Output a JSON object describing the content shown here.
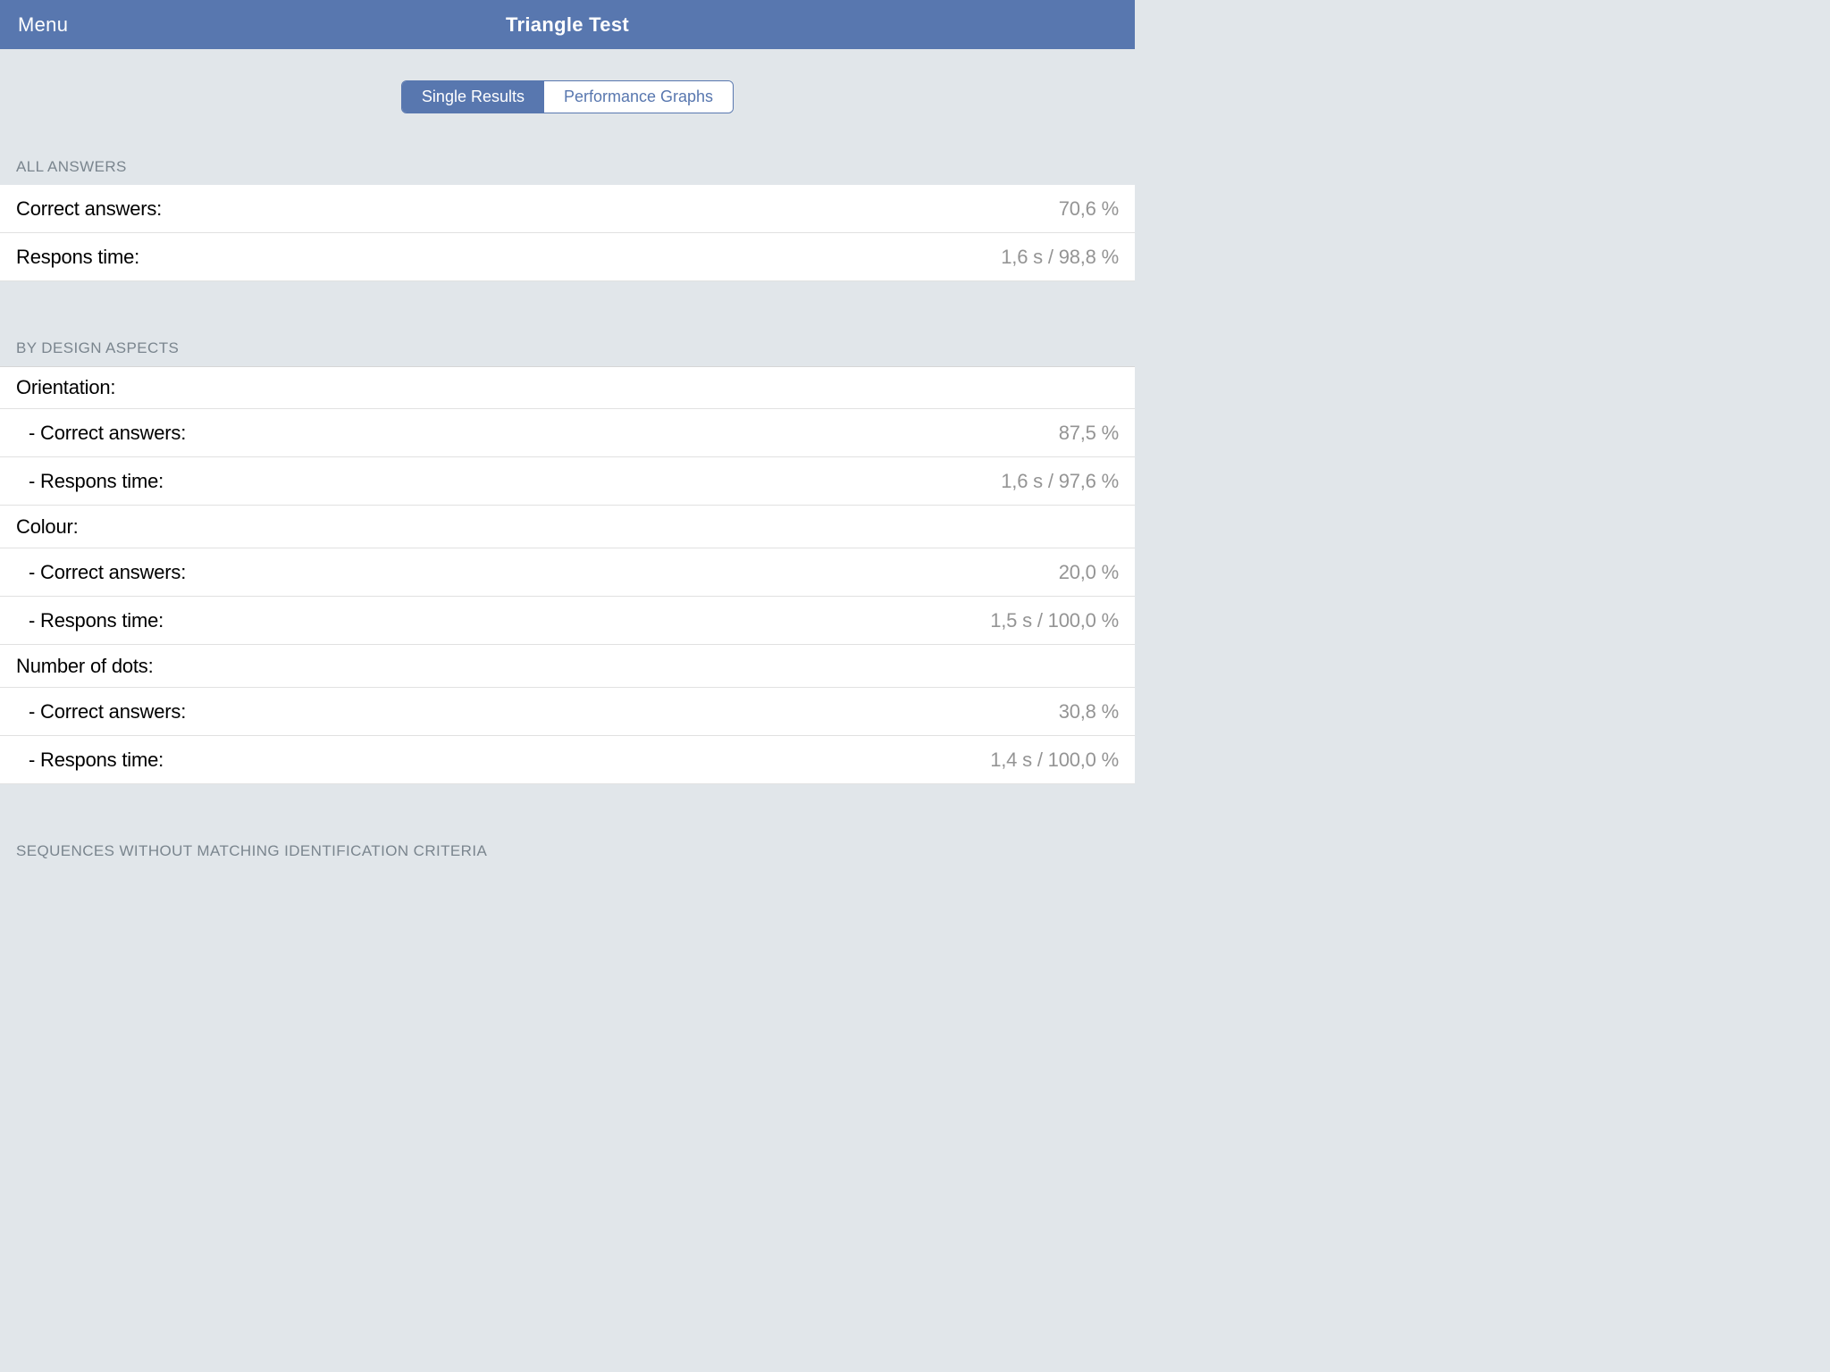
{
  "nav": {
    "menu": "Menu",
    "title": "Triangle Test"
  },
  "tabs": {
    "single": "Single Results",
    "graphs": "Performance Graphs"
  },
  "sections": {
    "all_answers": {
      "header": "ALL ANSWERS",
      "correct_label": "Correct answers:",
      "correct_value": "70,6 %",
      "respons_label": "Respons time:",
      "respons_value": "1,6 s / 98,8 %"
    },
    "by_design": {
      "header": "BY DESIGN ASPECTS",
      "orientation": {
        "title": "Orientation:",
        "correct_label": "- Correct answers:",
        "correct_value": "87,5 %",
        "respons_label": "- Respons time:",
        "respons_value": "1,6 s / 97,6 %"
      },
      "colour": {
        "title": "Colour:",
        "correct_label": "- Correct answers:",
        "correct_value": "20,0 %",
        "respons_label": "- Respons time:",
        "respons_value": "1,5 s / 100,0 %"
      },
      "dots": {
        "title": "Number of dots:",
        "correct_label": "- Correct answers:",
        "correct_value": "30,8 %",
        "respons_label": "- Respons time:",
        "respons_value": "1,4 s / 100,0 %"
      }
    },
    "sequences": {
      "header": "SEQUENCES WITHOUT MATCHING IDENTIFICATION CRITERIA"
    }
  }
}
